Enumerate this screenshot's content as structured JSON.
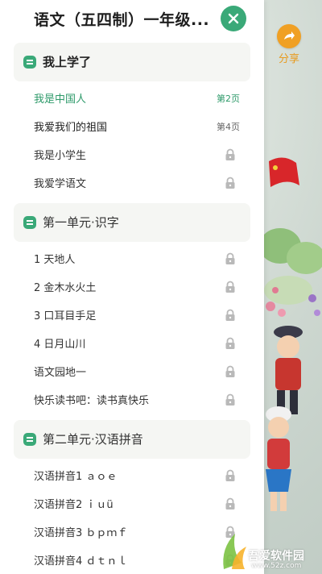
{
  "header": {
    "title": "语文（五四制）一年级..."
  },
  "share": {
    "label": "分享"
  },
  "sections": [
    {
      "title": "我上学了",
      "items": [
        {
          "label": "我是中国人",
          "page": "第2页",
          "state": "active"
        },
        {
          "label": "我爱我们的祖国",
          "page": "第4页",
          "state": "unlocked"
        },
        {
          "label": "我是小学生",
          "page": "",
          "state": "locked"
        },
        {
          "label": "我爱学语文",
          "page": "",
          "state": "locked"
        }
      ]
    },
    {
      "title": "第一单元·识字",
      "items": [
        {
          "label": "1 天地人",
          "state": "locked"
        },
        {
          "label": "2 金木水火土",
          "state": "locked"
        },
        {
          "label": "3 口耳目手足",
          "state": "locked"
        },
        {
          "label": "4 日月山川",
          "state": "locked"
        },
        {
          "label": "语文园地一",
          "state": "locked"
        },
        {
          "label": "快乐读书吧：读书真快乐",
          "state": "locked"
        }
      ]
    },
    {
      "title": "第二单元·汉语拼音",
      "items": [
        {
          "label": "汉语拼音1 ａｏｅ",
          "state": "locked"
        },
        {
          "label": "汉语拼音2 ｉｕü",
          "state": "locked"
        },
        {
          "label": "汉语拼音3 ｂｐｍｆ",
          "state": "locked"
        },
        {
          "label": "汉语拼音4 ｄｔｎｌ",
          "state": "locked"
        }
      ]
    }
  ],
  "icons": {
    "close": "close-icon",
    "share": "share-arrow-icon",
    "lock": "lock-icon",
    "section": "book-icon"
  },
  "colors": {
    "accent": "#3aa978",
    "active_text": "#2e9a6a",
    "share_orange": "#f0a024",
    "section_bg": "#f5f6f3"
  },
  "watermark": {
    "text": "吾爱软件园",
    "url": "www.52z.com"
  }
}
